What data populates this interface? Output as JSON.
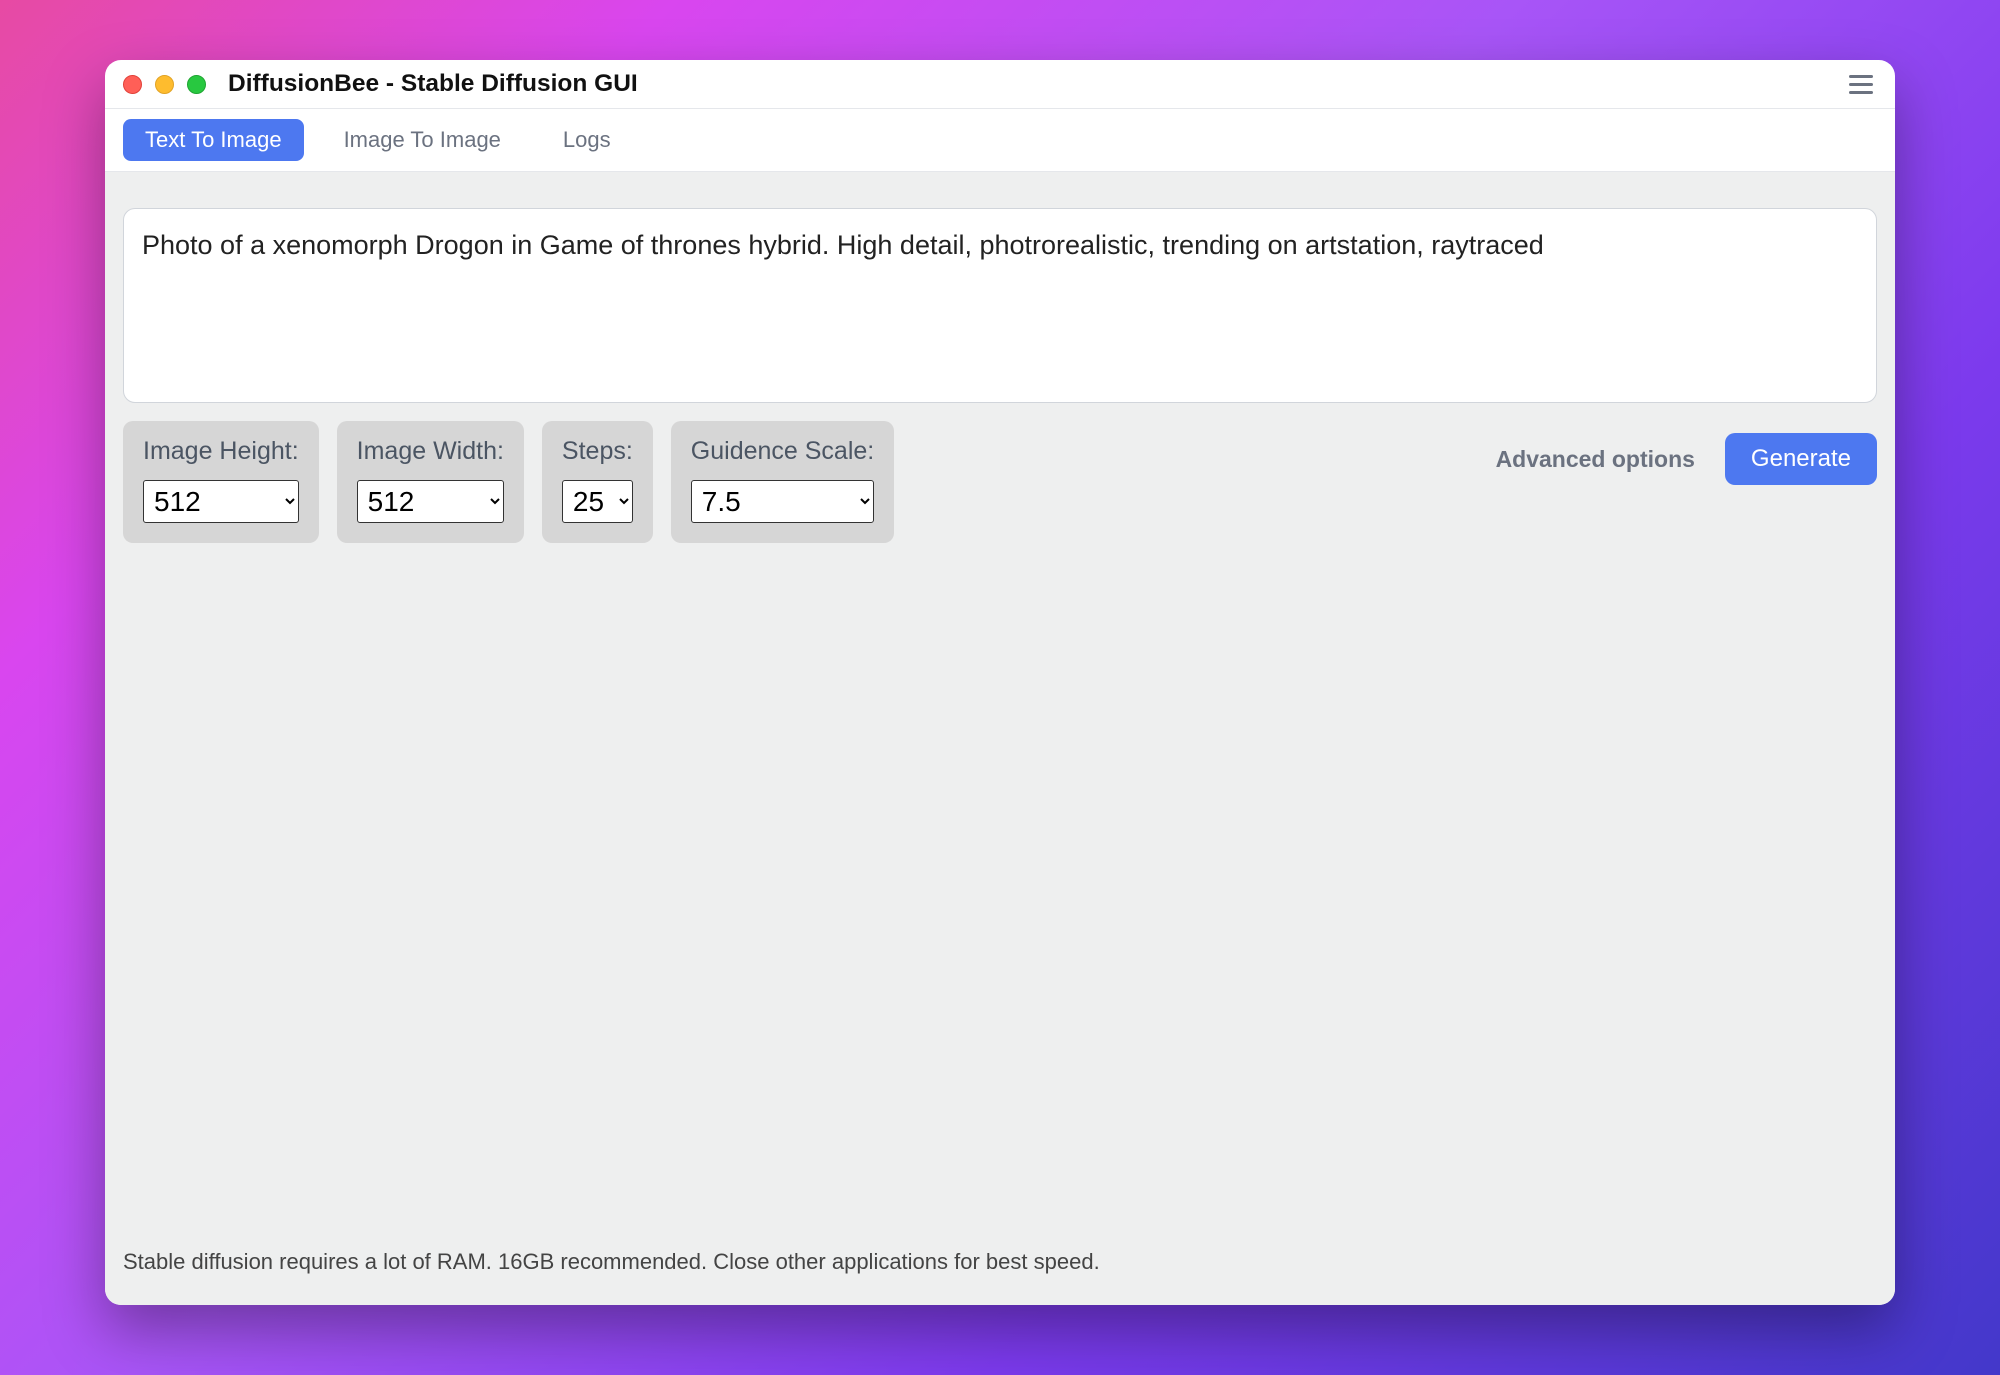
{
  "window": {
    "title": "DiffusionBee - Stable Diffusion GUI"
  },
  "tabs": {
    "text_to_image": "Text To Image",
    "image_to_image": "Image To Image",
    "logs": "Logs"
  },
  "prompt": {
    "value": "Photo of a xenomorph Drogon in Game of thrones hybrid. High detail, photrorealistic, trending on artstation, raytraced"
  },
  "options": {
    "height": {
      "label": "Image Height:",
      "value": "512"
    },
    "width": {
      "label": "Image Width:",
      "value": "512"
    },
    "steps": {
      "label": "Steps:",
      "value": "25"
    },
    "cfg": {
      "label": "Guidence Scale:",
      "value": "7.5"
    }
  },
  "advanced_label": "Advanced options",
  "generate_label": "Generate",
  "footer": "Stable diffusion requires a lot of RAM. 16GB recommended. Close other applications for best speed."
}
